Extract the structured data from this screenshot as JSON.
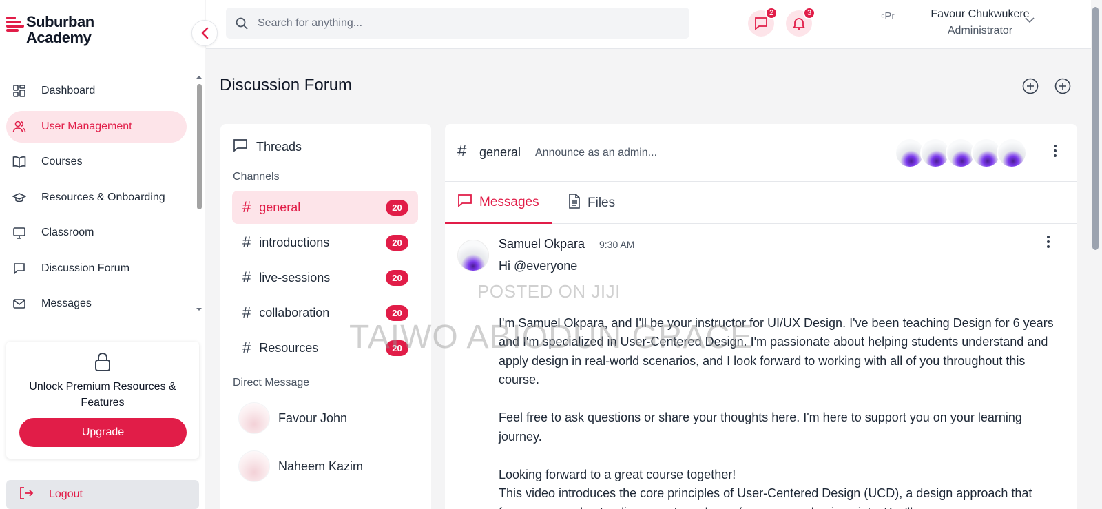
{
  "app": {
    "logo_line1": "Suburban",
    "logo_line2": "Academy",
    "accent": "#e11d48"
  },
  "sidebar": {
    "items": [
      {
        "label": "Dashboard",
        "icon": "dashboard-icon",
        "active": false
      },
      {
        "label": "User Management",
        "icon": "users-icon",
        "active": true
      },
      {
        "label": "Courses",
        "icon": "book-icon",
        "active": false
      },
      {
        "label": "Resources & Onboarding",
        "icon": "graduation-cap-icon",
        "active": false
      },
      {
        "label": "Classroom",
        "icon": "monitor-icon",
        "active": false
      },
      {
        "label": "Discussion Forum",
        "icon": "chat-bubble-icon",
        "active": false
      },
      {
        "label": "Messages",
        "icon": "mail-icon",
        "active": false
      }
    ],
    "upgrade_text": "Unlock Premium Resources & Features",
    "upgrade_button": "Upgrade",
    "logout_label": "Logout"
  },
  "header": {
    "search_placeholder": "Search for anything...",
    "messages_count": "2",
    "notifications_count": "3",
    "profile_image_alt": "Pr",
    "profile_name": "Favour Chukwukere",
    "profile_role": "Administrator"
  },
  "main": {
    "title": "Discussion Forum"
  },
  "threads": {
    "heading": "Threads",
    "channels_label": "Channels",
    "channels": [
      {
        "name": "general",
        "count": "20",
        "active": true
      },
      {
        "name": "introductions",
        "count": "20",
        "active": false
      },
      {
        "name": "live-sessions",
        "count": "20",
        "active": false
      },
      {
        "name": "collaboration",
        "count": "20",
        "active": false
      },
      {
        "name": "Resources",
        "count": "20",
        "active": false
      }
    ],
    "dm_label": "Direct Message",
    "direct_messages": [
      {
        "name": "Favour John"
      },
      {
        "name": "Naheem Kazim"
      }
    ]
  },
  "chat": {
    "channel": "general",
    "description": "Announce as an admin...",
    "tabs": [
      {
        "label": "Messages",
        "active": true
      },
      {
        "label": "Files",
        "active": false
      }
    ],
    "message": {
      "author": "Samuel Okpara",
      "time": "9:30 AM",
      "greeting": "Hi @everyone",
      "para1": "I'm Samuel Okpara, and I'll be your instructor for UI/UX Design. I've been teaching Design for 6 years and I'm specialized in User-Centered Design. I'm passionate about helping students understand and apply design in real-world scenarios, and I look forward to working with all of you throughout this course.",
      "para2": "Feel free to ask questions or share your thoughts here. I'm here to support you on your learning journey.",
      "para3": "Looking forward to a great course together!",
      "para4": "This video introduces the core principles of User-Centered Design (UCD), a design approach that focuses on understanding users' needs, preferences, and pain points. You'll"
    }
  },
  "watermark": {
    "line1": "POSTED ON JIJI",
    "line2": "TAIWO ABIODUN GRACE"
  }
}
